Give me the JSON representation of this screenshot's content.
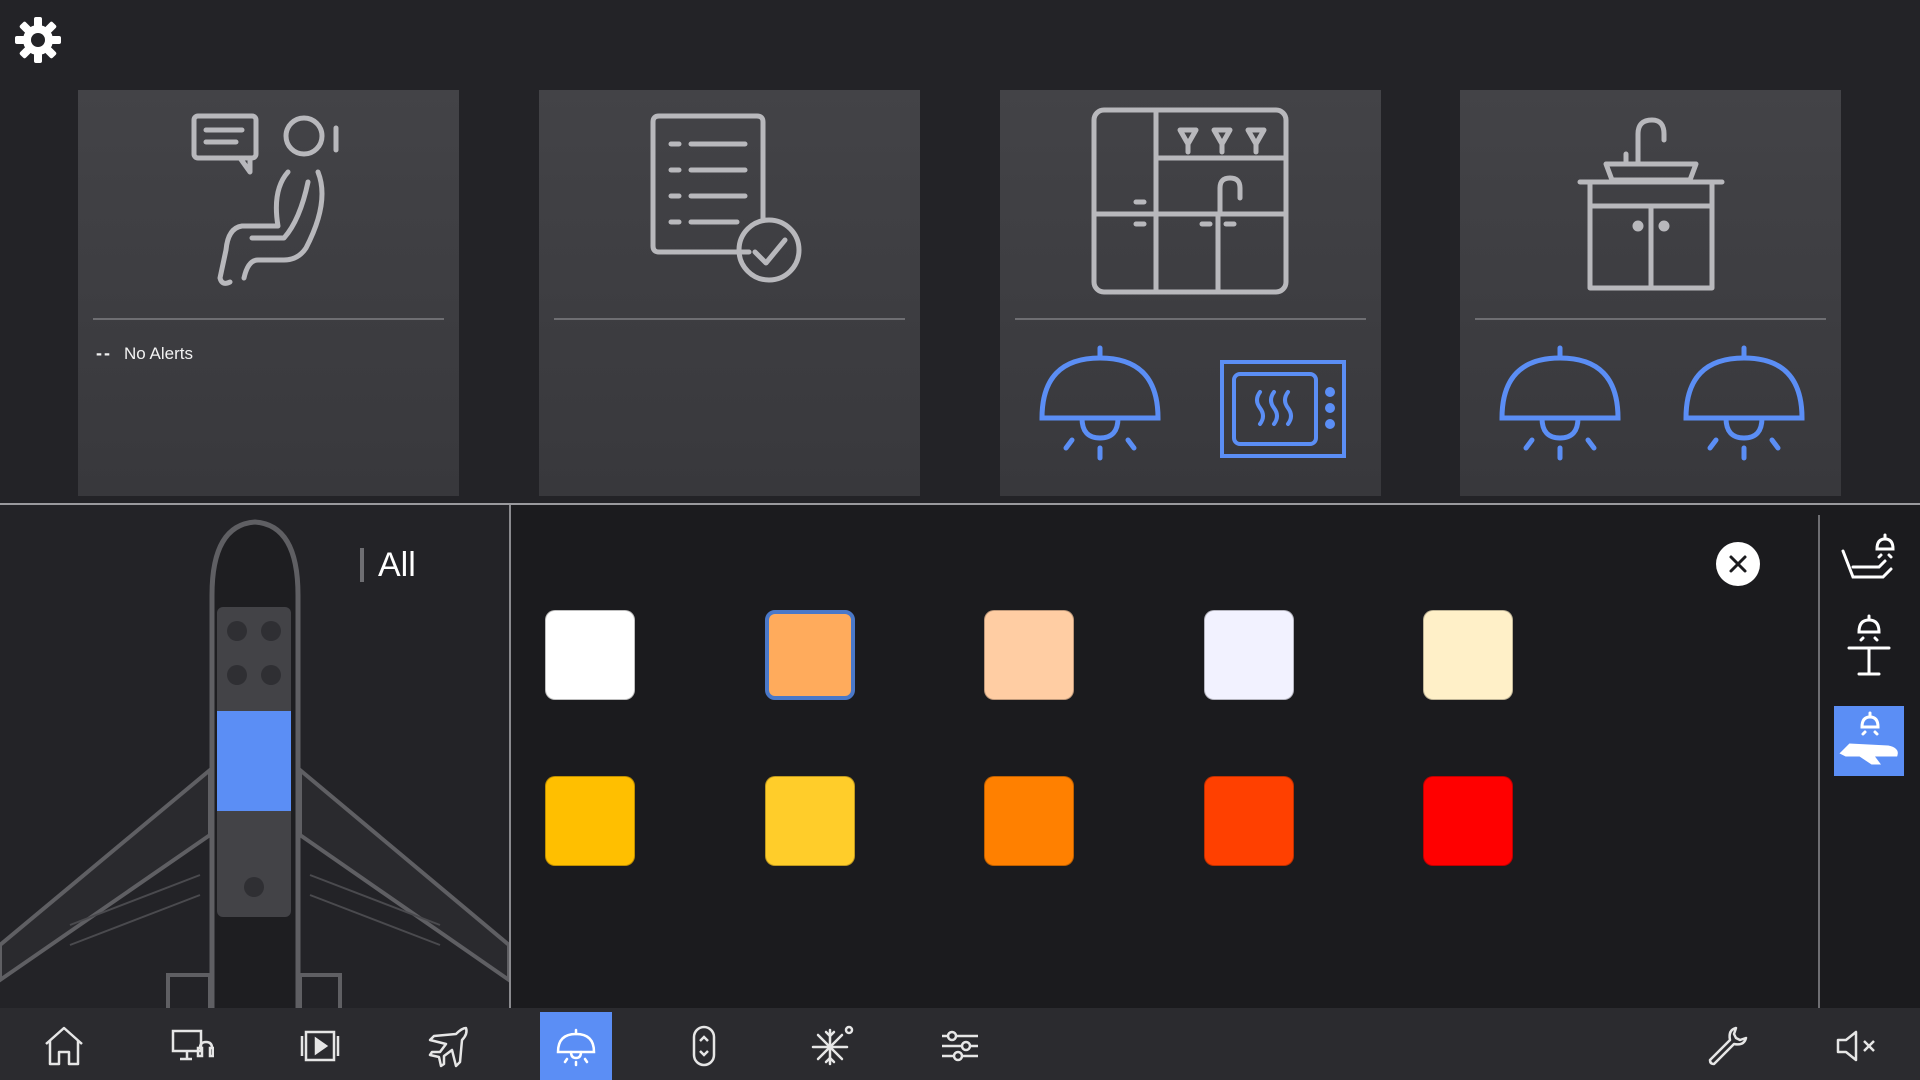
{
  "settings": {
    "icon": "gear-icon"
  },
  "cards": [
    {
      "name": "passenger-card",
      "icon": "seat-chat-icon",
      "alert_dash": "--",
      "alert_text": "No Alerts"
    },
    {
      "name": "checklist-card",
      "icon": "checklist-icon"
    },
    {
      "name": "galley-card",
      "icon": "galley-icon",
      "controls": [
        "pendant-light-icon",
        "oven-icon"
      ]
    },
    {
      "name": "lavatory-card",
      "icon": "vanity-icon",
      "controls": [
        "pendant-light-icon",
        "pendant-light-icon"
      ]
    }
  ],
  "zone_panel": {
    "label": "All",
    "selected_section": "mid-cabin"
  },
  "swatches": [
    {
      "color": "#ffffff",
      "selected": false
    },
    {
      "color": "#ffab5c",
      "selected": true
    },
    {
      "color": "#ffcda3",
      "selected": false
    },
    {
      "color": "#f2f2ff",
      "selected": false
    },
    {
      "color": "#fff0c8",
      "selected": false
    },
    {
      "color": "#ffbf00",
      "selected": false
    },
    {
      "color": "#ffcd2a",
      "selected": false
    },
    {
      "color": "#ff8000",
      "selected": false
    },
    {
      "color": "#ff4000",
      "selected": false
    },
    {
      "color": "#ff0000",
      "selected": false
    }
  ],
  "zone_buttons": [
    {
      "icon": "seat-light-icon",
      "active": false
    },
    {
      "icon": "table-light-icon",
      "active": false
    },
    {
      "icon": "cabin-light-icon",
      "active": true
    }
  ],
  "nav": [
    {
      "icon": "home-icon",
      "active": false
    },
    {
      "icon": "monitor-icon",
      "active": false
    },
    {
      "icon": "media-play-icon",
      "active": false
    },
    {
      "icon": "flight-icon",
      "active": false
    },
    {
      "icon": "lighting-icon",
      "active": true
    },
    {
      "icon": "window-shade-icon",
      "active": false
    },
    {
      "icon": "climate-icon",
      "active": false
    },
    {
      "icon": "settings-sliders-icon",
      "active": false
    },
    {
      "icon": "wrench-icon",
      "active": false
    },
    {
      "icon": "mute-icon",
      "active": false
    }
  ],
  "colors": {
    "accent": "#5b8ef5",
    "bg": "#232327",
    "card": "#3c3c40",
    "icon_outline": "#9a9a9e"
  }
}
